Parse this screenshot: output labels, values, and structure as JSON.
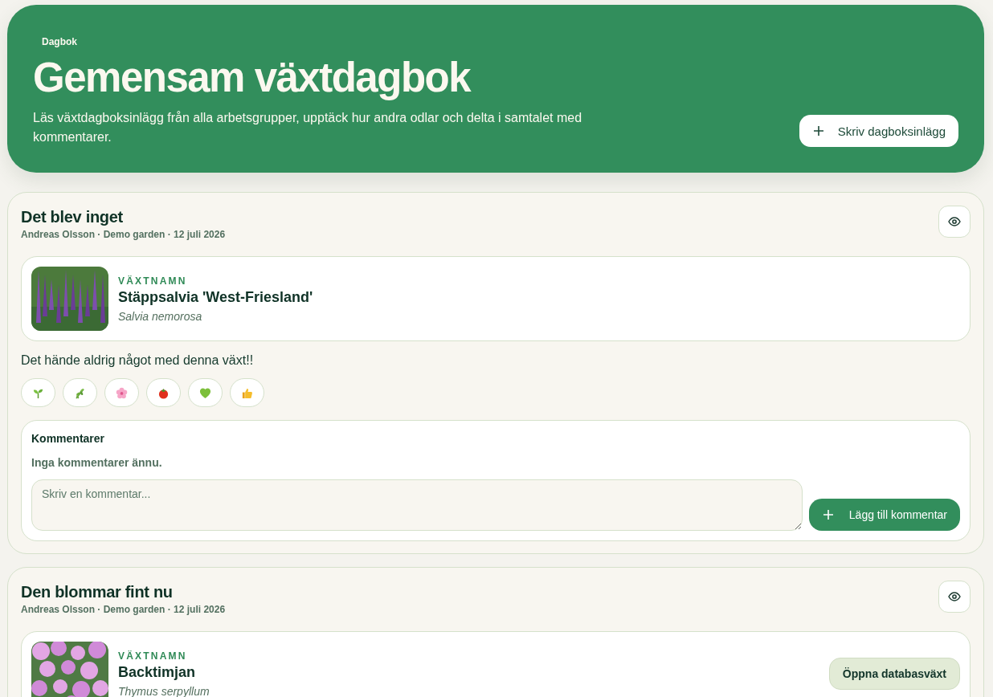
{
  "header": {
    "badge": "Dagbok",
    "title": "Gemensam växtdagbok",
    "description": "Läs växtdagboksinlägg från alla arbetsgrupper, upptäck hur andra odlar och delta i samtalet med kommentarer.",
    "action_button": "Skriv dagboksinlägg"
  },
  "entries": [
    {
      "title": "Det blev inget",
      "meta": "Andreas Olsson · Demo garden · 12 juli 2026",
      "plant": {
        "label": "VÄXTNAMN",
        "name": "Stäppsalvia 'West-Friesland'",
        "latin": "Salvia nemorosa"
      },
      "text": "Det hände aldrig något med denna växt!!",
      "reactions": [
        {
          "kind": "sprout"
        },
        {
          "kind": "herb"
        },
        {
          "kind": "blossom"
        },
        {
          "kind": "tomato"
        },
        {
          "kind": "heart"
        },
        {
          "kind": "thumbs"
        }
      ],
      "comments": {
        "heading": "Kommentarer",
        "empty_text": "Inga kommentarer ännu.",
        "placeholder": "Skriv en kommentar...",
        "submit_button": "Lägg till kommentar"
      }
    },
    {
      "title": "Den blommar fint nu",
      "meta": "Andreas Olsson · Demo garden · 12 juli 2026",
      "plant": {
        "label": "VÄXTNAMN",
        "name": "Backtimjan",
        "latin": "Thymus serpyllum",
        "open_button": "Öppna databasväxt"
      }
    }
  ]
}
